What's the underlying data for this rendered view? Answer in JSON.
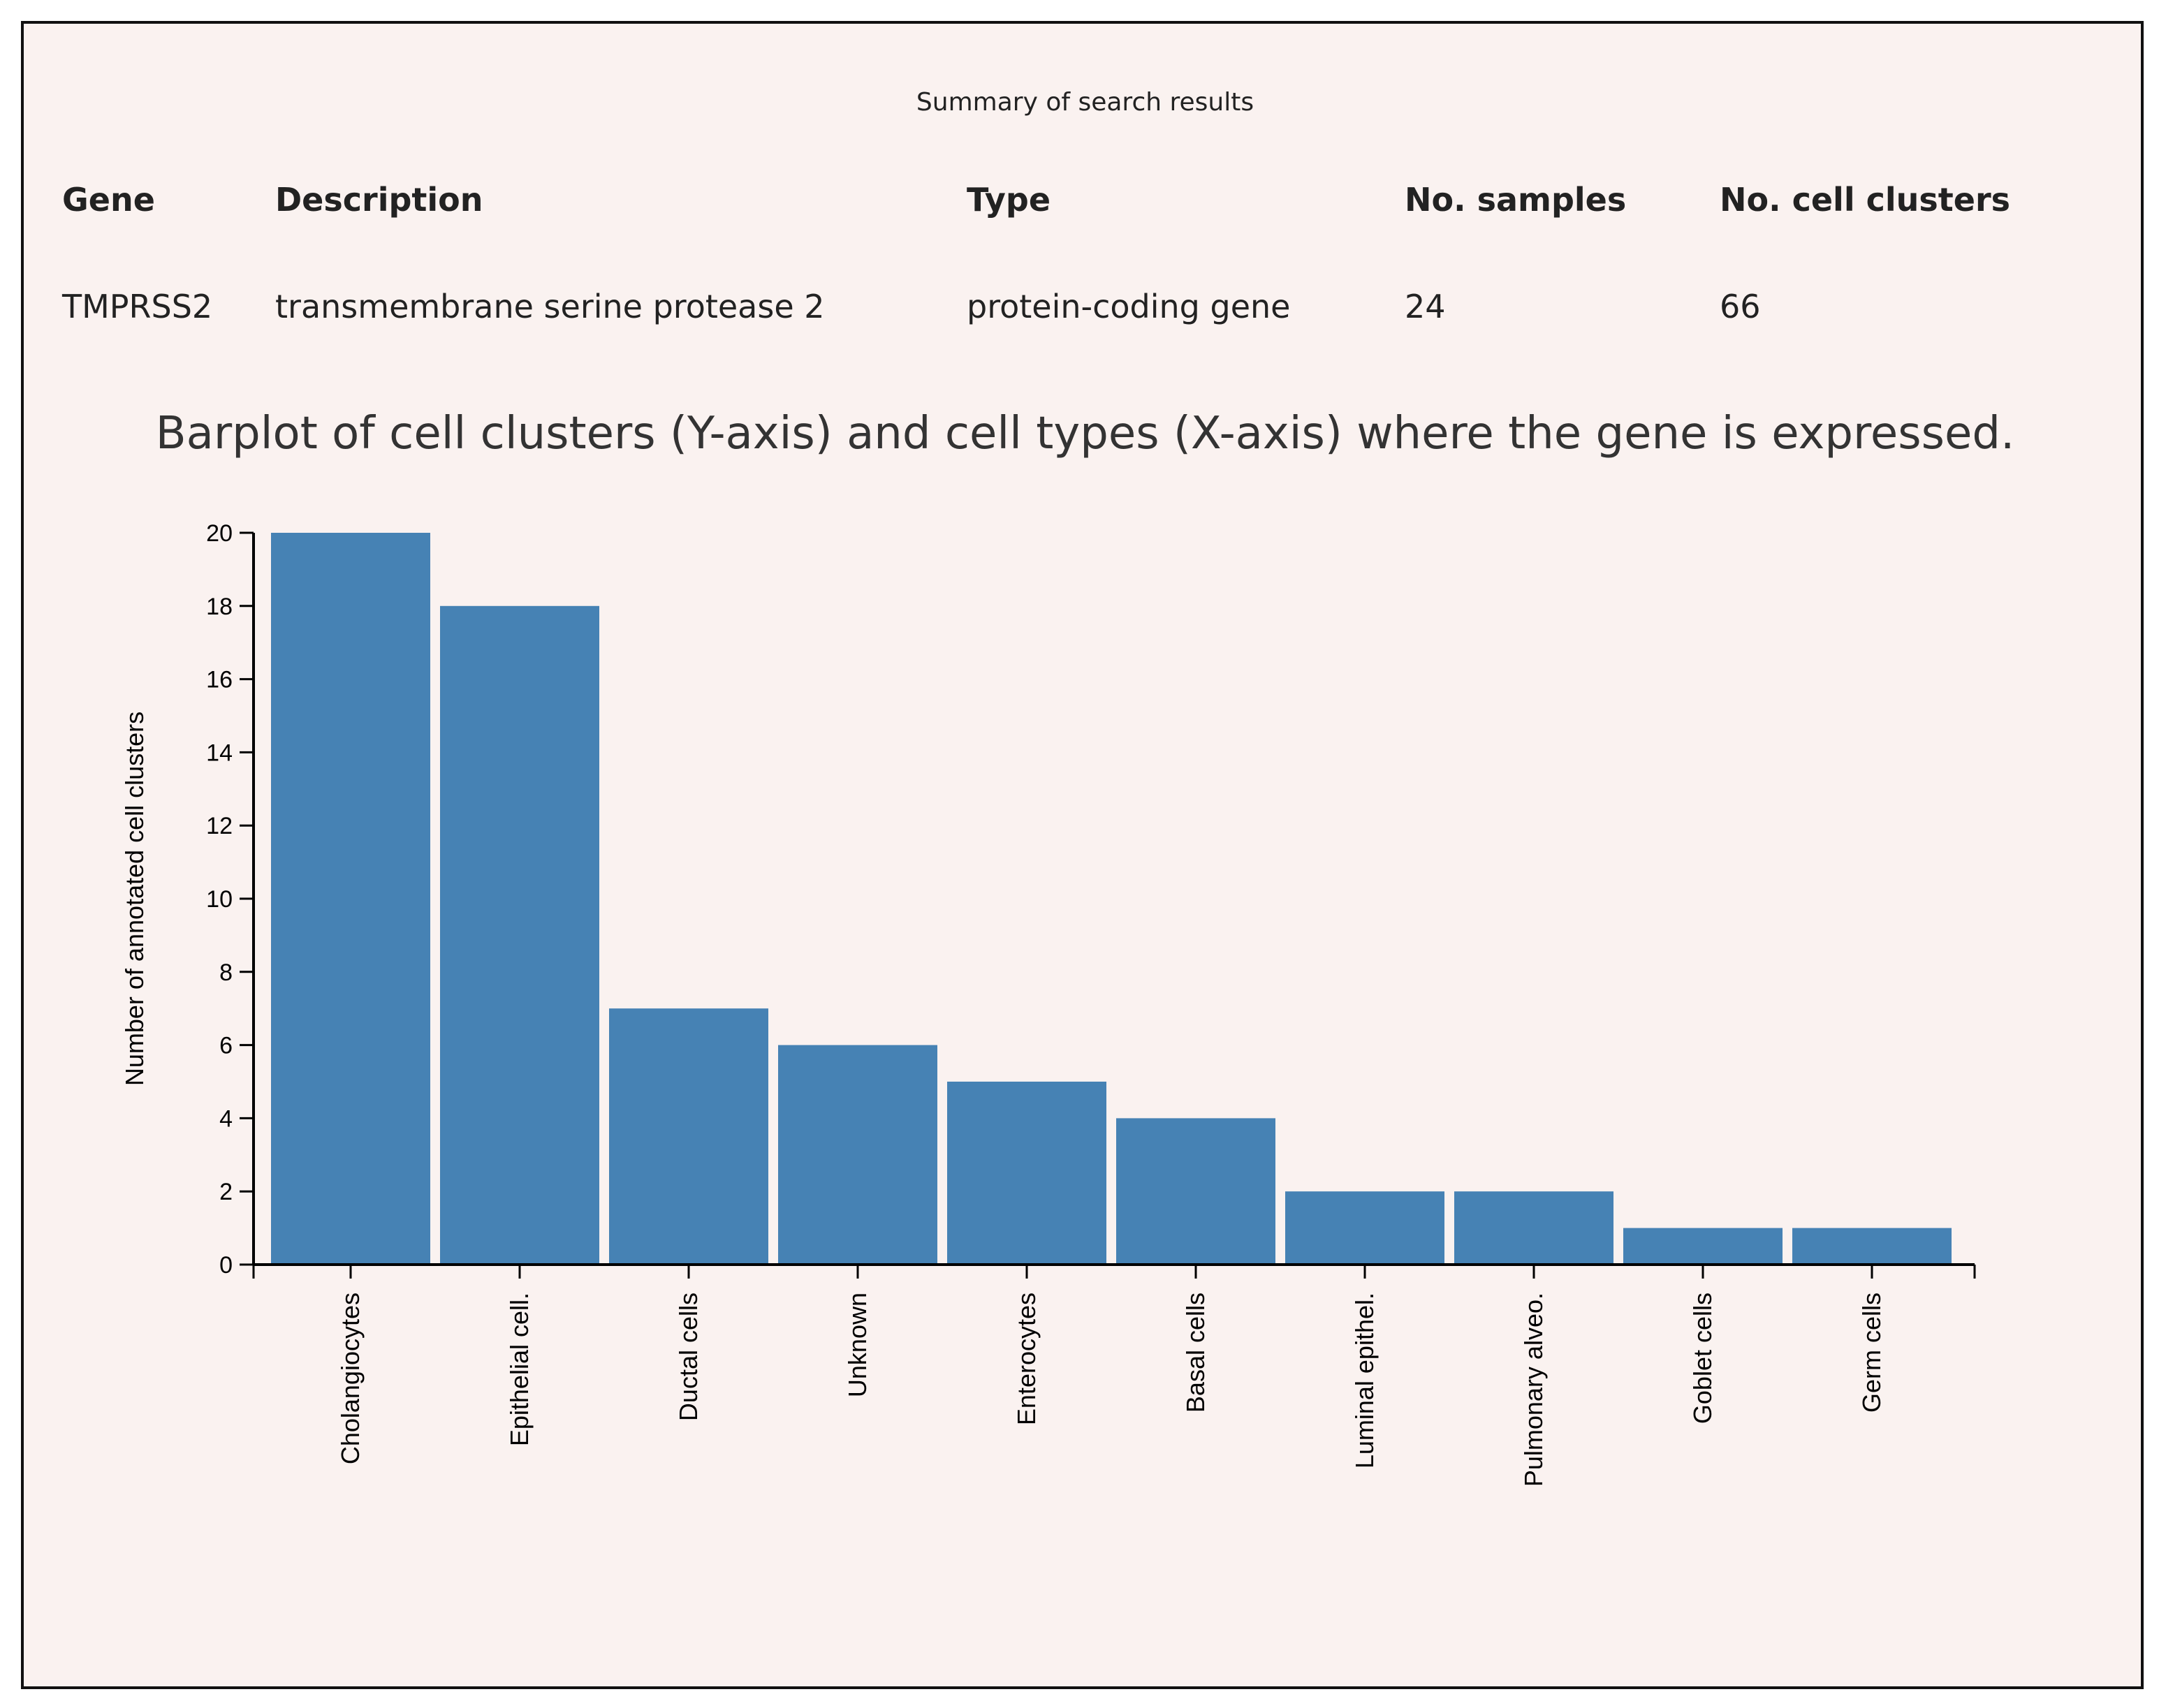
{
  "summary": {
    "title": "Summary of search results",
    "headers": [
      "Gene",
      "Description",
      "Type",
      "No. samples",
      "No. cell clusters"
    ],
    "row": [
      "TMPRSS2",
      "transmembrane serine protease 2",
      "protein-coding gene",
      "24",
      "66"
    ]
  },
  "chart_data": {
    "type": "bar",
    "title": "Barplot of cell clusters (Y-axis) and cell types (X-axis) where the gene is expressed.",
    "xlabel": "",
    "ylabel": "Number of annotated cell clusters",
    "categories": [
      "Cholangiocytes",
      "Epithelial cell.",
      "Ductal cells",
      "Unknown",
      "Enterocytes",
      "Basal cells",
      "Luminal epithel.",
      "Pulmonary alveo.",
      "Goblet cells",
      "Germ cells"
    ],
    "values": [
      20,
      18,
      7,
      6,
      5,
      4,
      2,
      2,
      1,
      1
    ],
    "ylim": [
      0,
      20
    ],
    "yticks": [
      "0",
      "2",
      "4",
      "6",
      "8",
      "10",
      "12",
      "14",
      "16",
      "18",
      "20"
    ],
    "bar_color": "#4682b4",
    "grid": false
  }
}
